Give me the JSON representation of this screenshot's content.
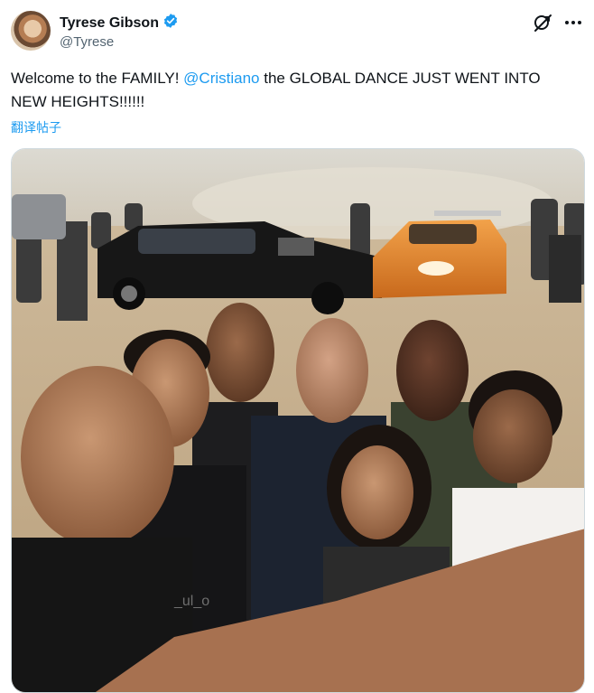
{
  "author": {
    "display_name": "Tyrese Gibson",
    "handle": "@Tyrese"
  },
  "tweet": {
    "text_before": "Welcome to the FAMILY! ",
    "mention": "@Cristiano",
    "text_after": " the GLOBAL DANCE JUST WENT INTO NEW HEIGHTS!!!!!!",
    "translate_label": "翻译帖子"
  },
  "media": {
    "shirt_text": "_ul_o"
  },
  "icons": {
    "verified": "verified-badge-icon",
    "grok": "grok-icon",
    "more": "more-options-icon"
  },
  "colors": {
    "accent": "#1d9bf0",
    "verified": "#1d9bf0",
    "secondary_text": "#536471"
  }
}
